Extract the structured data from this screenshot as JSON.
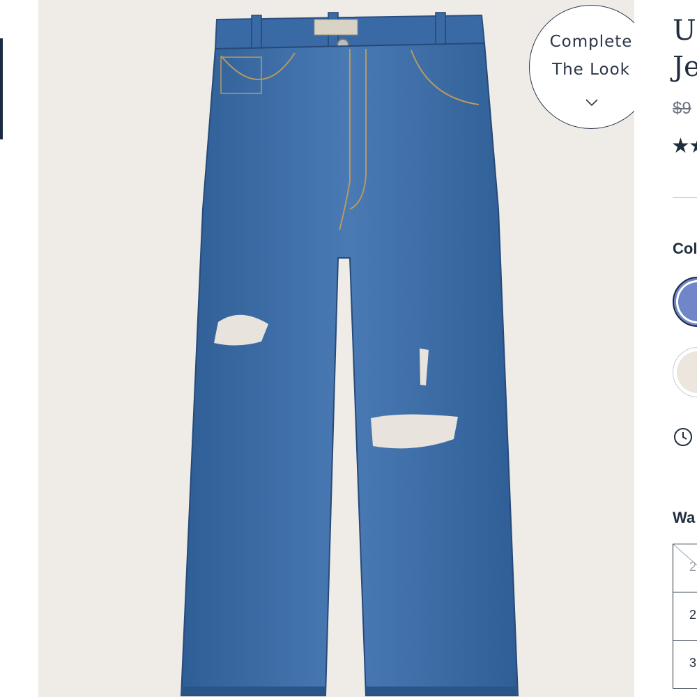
{
  "image_panel": {
    "complete_look_line1": "Complete",
    "complete_look_line2": "The Look"
  },
  "product": {
    "title_line1": "U",
    "title_line2": "Je",
    "price": "$9",
    "stars": "★★",
    "color_label": "Col",
    "waist_label": "Wa",
    "sizes": [
      {
        "label": "2",
        "available": false
      },
      {
        "label": "2",
        "available": true
      },
      {
        "label": "3",
        "available": true
      }
    ]
  },
  "colors": {
    "denim": "#3f6ea8",
    "background": "#efebe7",
    "navy": "#1b2a44"
  }
}
